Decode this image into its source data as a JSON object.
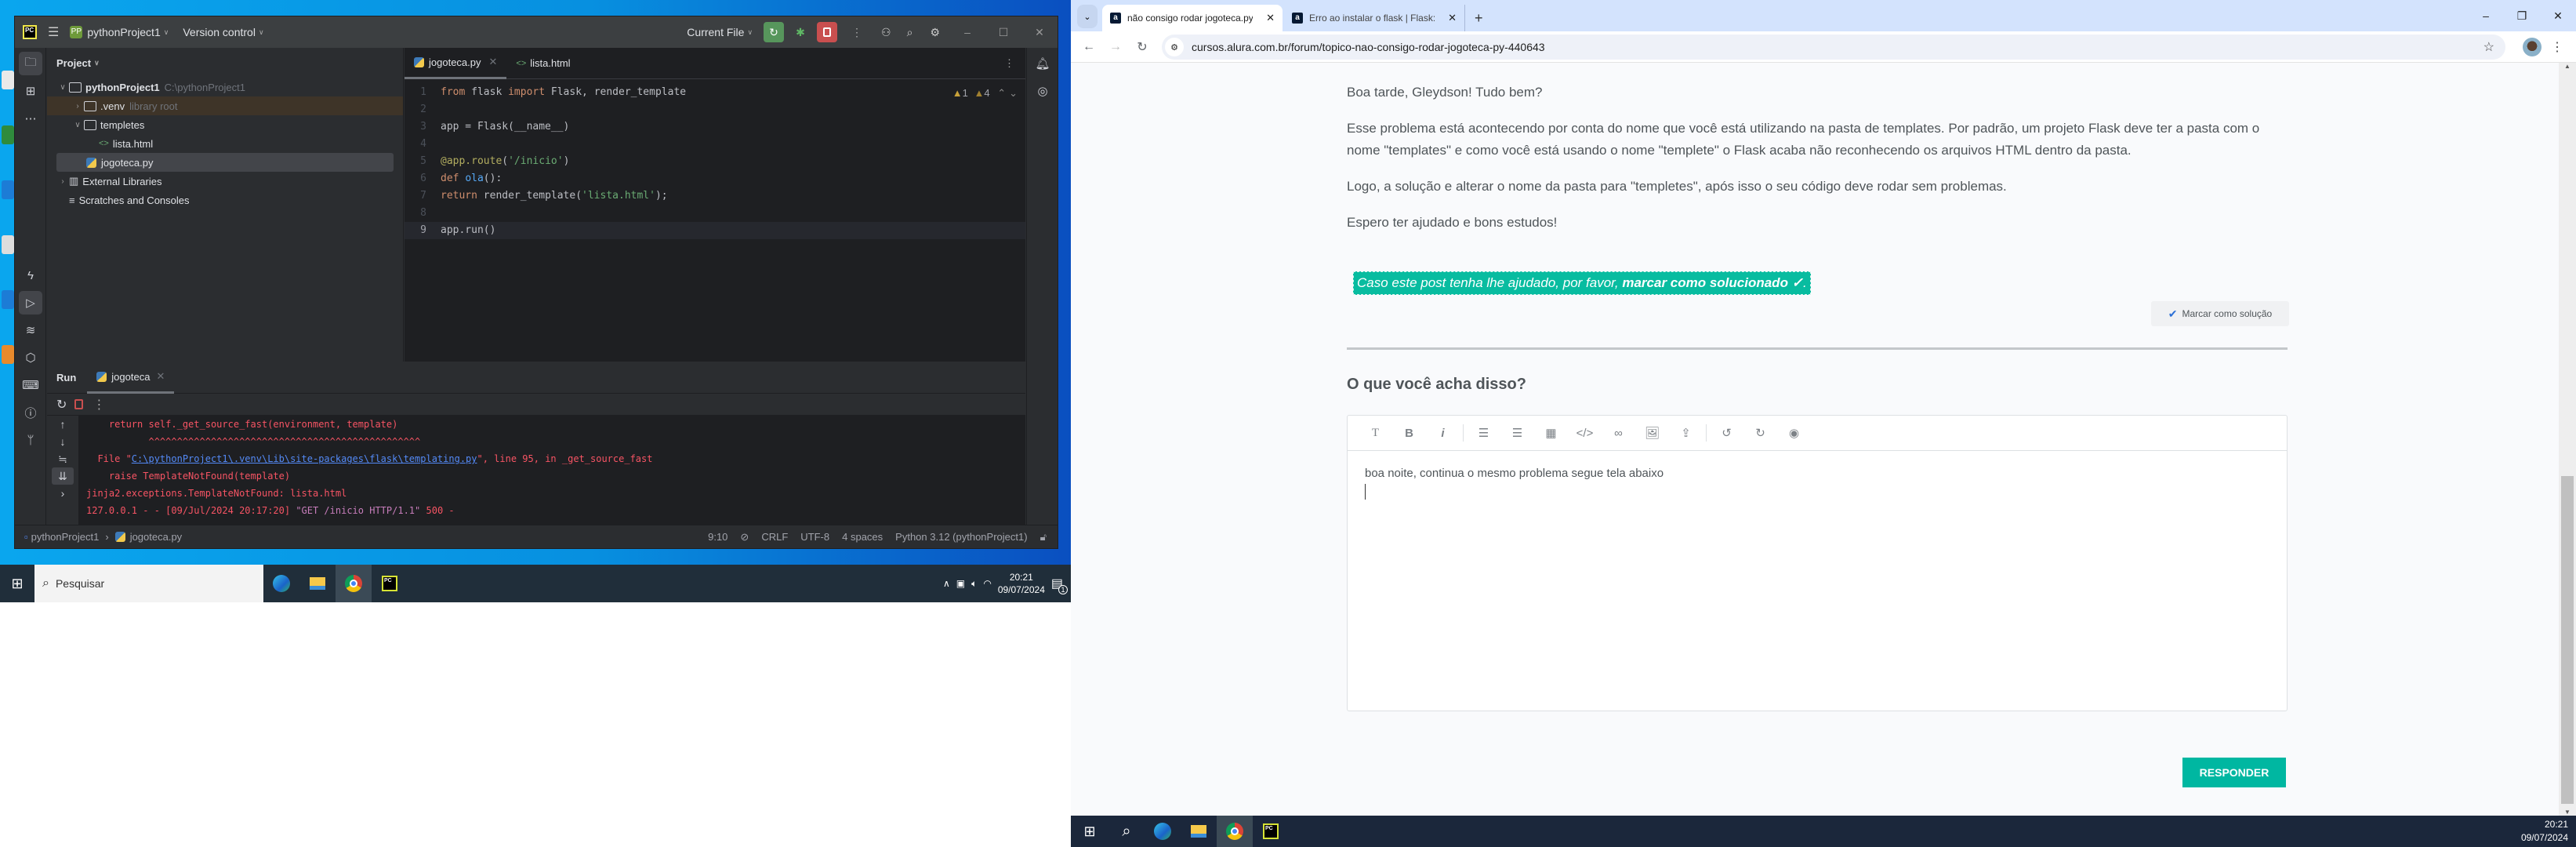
{
  "pycharm": {
    "project_name": "pythonProject1",
    "project_badge": "PP",
    "version_control": "Version control",
    "run_config": "Current File",
    "project_panel_title": "Project",
    "tree": [
      {
        "label": "pythonProject1",
        "hint": "C:\\pythonProject1",
        "depth": 0,
        "expanded": true,
        "type": "folder"
      },
      {
        "label": ".venv",
        "hint": "library root",
        "depth": 1,
        "expanded": false,
        "type": "folder"
      },
      {
        "label": "templetes",
        "hint": "",
        "depth": 1,
        "expanded": true,
        "type": "folder"
      },
      {
        "label": "lista.html",
        "hint": "",
        "depth": 2,
        "type": "html"
      },
      {
        "label": "jogoteca.py",
        "hint": "",
        "depth": 1,
        "type": "python",
        "selected": true
      },
      {
        "label": "External Libraries",
        "hint": "",
        "depth": 0,
        "expanded": false,
        "type": "library"
      },
      {
        "label": "Scratches and Consoles",
        "hint": "",
        "depth": 0,
        "type": "scratches"
      }
    ],
    "editor_tabs": [
      {
        "label": "jogoteca.py",
        "active": true
      },
      {
        "label": "lista.html",
        "active": false
      }
    ],
    "inspections": {
      "errors": "1",
      "warnings": "4"
    },
    "code_lines": [
      "from flask import Flask, render_template",
      "",
      "app = Flask(__name__)",
      "",
      "@app.route('/inicio')",
      "def ola():",
      "    return render_template('lista.html');",
      "",
      "app.run()"
    ],
    "run_panel": {
      "title": "Run",
      "tab": "jogoteca",
      "console": [
        "    return self._get_source_fast(environment, template)",
        "           ^^^^^^^^^^^^^^^^^^^^^^^^^^^^^^^^^^^^^^^^^^^^^^^^",
        "  File \"",
        "    raise TemplateNotFound(template)",
        "jinja2.exceptions.TemplateNotFound: lista.html",
        "127.0.0.1 - - [09/Jul/2024 20:17:20] "
      ],
      "file_link": "C:\\pythonProject1\\.venv\\Lib\\site-packages\\flask\\templating.py",
      "file_suffix": "\", line 95, in _get_source_fast",
      "get_request": "\"GET /inicio HTTP/1.1\"",
      "status_suffix": " 500 -"
    },
    "status_bar": {
      "breadcrumb_project": "pythonProject1",
      "breadcrumb_file": "jogoteca.py",
      "position": "9:10",
      "line_sep": "CRLF",
      "encoding": "UTF-8",
      "indent": "4 spaces",
      "interpreter": "Python 3.12 (pythonProject1)"
    }
  },
  "left_taskbar": {
    "search_placeholder": "Pesquisar",
    "time": "20:21",
    "date": "09/07/2024",
    "notification_count": "1"
  },
  "browser": {
    "tabs": [
      {
        "title": "não consigo rodar jogoteca.py",
        "active": true,
        "favicon": "a"
      },
      {
        "title": "Erro ao instalar o flask | Flask: c",
        "active": false,
        "favicon": "a"
      }
    ],
    "url": "cursos.alura.com.br/forum/topico-nao-consigo-rodar-jogoteca-py-440643",
    "post": {
      "greeting": "Boa tarde, Gleydson! Tudo bem?",
      "paragraph1": "Esse problema está acontecendo por conta do nome que você está utilizando na pasta de templates. Por padrão, um projeto Flask deve ter a pasta com o nome \"templates\" e como você está usando o nome \"templete\" o Flask acaba não reconhecendo os arquivos HTML dentro da pasta.",
      "paragraph2": "Logo, a solução e alterar o nome da pasta para \"templetes\", após isso o seu código deve rodar sem problemas.",
      "paragraph3": "Espero ter ajudado e bons estudos!",
      "cta_prefix": "Caso este post tenha lhe ajudado, por favor, ",
      "cta_bold": "marcar como solucionado ✓",
      "cta_suffix": ".",
      "mark_solution": "Marcar como solução"
    },
    "reply": {
      "title": "O que você acha disso?",
      "draft": "boa noite, continua o mesmo problema segue tela abaixo",
      "submit": "RESPONDER"
    },
    "scroll_position": 0.55
  },
  "right_taskbar": {
    "time": "20:21",
    "date": "09/07/2024"
  }
}
